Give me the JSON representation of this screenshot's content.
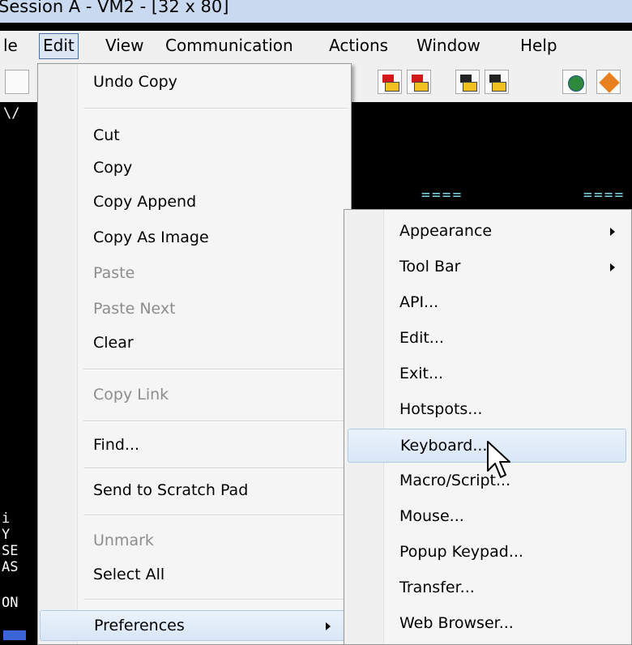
{
  "window": {
    "title": "Session A - VM2 - [32 x 80]"
  },
  "menubar": {
    "items": [
      {
        "label": "le",
        "active": false
      },
      {
        "label": "Edit",
        "active": true
      },
      {
        "label": "View",
        "active": false
      },
      {
        "label": "Communication",
        "active": false
      },
      {
        "label": "Actions",
        "active": false
      },
      {
        "label": "Window",
        "active": false
      },
      {
        "label": "Help",
        "active": false
      }
    ]
  },
  "toolbar": {
    "icons": [
      "record-macro-icon",
      "stop-macro-icon",
      "play-macro-icon",
      "macro-setup-icon",
      "globe-icon",
      "edit-tag-icon"
    ]
  },
  "terminal": {
    "fragments": [
      "\\/",
      "====",
      "====",
      "i",
      "Y",
      "SE",
      "AS",
      "ON"
    ]
  },
  "edit_menu": {
    "items": [
      {
        "label": "Undo Copy",
        "enabled": true
      },
      {
        "label": "Cut",
        "enabled": true
      },
      {
        "label": "Copy",
        "enabled": true
      },
      {
        "label": "Copy Append",
        "enabled": true
      },
      {
        "label": "Copy As Image",
        "enabled": true
      },
      {
        "label": "Paste",
        "enabled": false
      },
      {
        "label": "Paste Next",
        "enabled": false
      },
      {
        "label": "Clear",
        "enabled": true
      },
      {
        "label": "Copy Link",
        "enabled": false
      },
      {
        "label": "Find...",
        "enabled": true
      },
      {
        "label": "Send to Scratch Pad",
        "enabled": true
      },
      {
        "label": "Unmark",
        "enabled": false
      },
      {
        "label": "Select All",
        "enabled": true
      },
      {
        "label": "Preferences",
        "enabled": true,
        "submenu": true,
        "highlighted": true
      }
    ]
  },
  "preferences_menu": {
    "items": [
      {
        "label": "Appearance",
        "submenu": true
      },
      {
        "label": "Tool Bar",
        "submenu": true
      },
      {
        "label": "API..."
      },
      {
        "label": "Edit..."
      },
      {
        "label": "Exit..."
      },
      {
        "label": "Hotspots..."
      },
      {
        "label": "Keyboard...",
        "highlighted": true
      },
      {
        "label": "Macro/Script..."
      },
      {
        "label": "Mouse..."
      },
      {
        "label": "Popup Keypad..."
      },
      {
        "label": "Transfer..."
      },
      {
        "label": "Web Browser..."
      }
    ]
  },
  "colors": {
    "highlight": "#d8e6f6",
    "highlight_border": "#aecbeb",
    "disabled_text": "#8d8d8d",
    "terminal_cyan": "#7fd7e8"
  }
}
